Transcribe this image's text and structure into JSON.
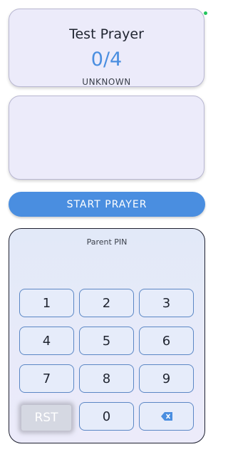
{
  "prayer": {
    "title": "Test Prayer",
    "count": "0/4",
    "status": "UNKNOWN"
  },
  "actions": {
    "start_label": "START PRAYER"
  },
  "pin_pad": {
    "label": "Parent PIN",
    "keys": [
      "1",
      "2",
      "3",
      "4",
      "5",
      "6",
      "7",
      "8",
      "9",
      "0"
    ],
    "reset_label": "RST",
    "backspace_icon": "backspace-icon"
  },
  "colors": {
    "accent": "#4a8ee0",
    "card_bg": "#ecebfa",
    "status_dot": "#22c55e"
  }
}
